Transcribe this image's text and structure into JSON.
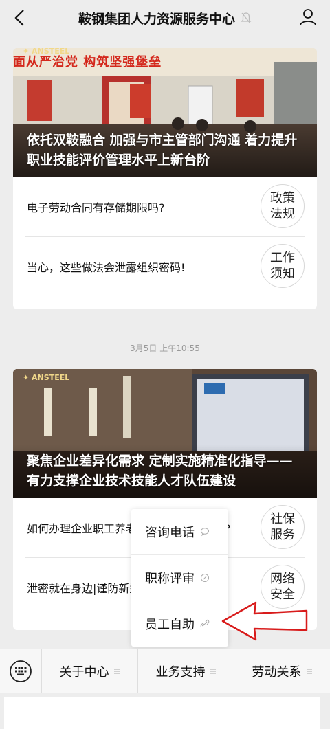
{
  "header": {
    "title": "鞍钢集团人力资源服务中心"
  },
  "card1": {
    "brand": "✦ ANSTEEL",
    "banner": "面从严治党 构筑坚强堡垒",
    "headline": "依托双鞍融合 加强与市主管部门沟通 着力提升职业技能评价管理水平上新台阶",
    "rows": [
      {
        "text": "电子劳动合同有存储期限吗?",
        "thumb": [
          "政策",
          "法规"
        ]
      },
      {
        "text": "当心，这些做法会泄露组织密码!",
        "thumb": [
          "工作",
          "须知"
        ]
      }
    ]
  },
  "timestamp": "3月5日 上午10:55",
  "card2": {
    "brand": "✦ ANSTEEL",
    "headline": "聚焦企业差异化需求 定制实施精准化指导——有力支撑企业技术技能人才队伍建设",
    "rows": [
      {
        "text": "如何办理企业职工养老保险关系转移接续?",
        "thumb": [
          "社保",
          "服务"
        ]
      },
      {
        "text": "泄密就在身边|谨防新型网络诈骗手段揭秘",
        "thumb": [
          "网络",
          "安全"
        ]
      }
    ]
  },
  "popup": {
    "items": [
      "咨询电话",
      "职称评审",
      "员工自助"
    ]
  },
  "menu": {
    "items": [
      "关于中心",
      "业务支持",
      "劳动关系"
    ]
  }
}
